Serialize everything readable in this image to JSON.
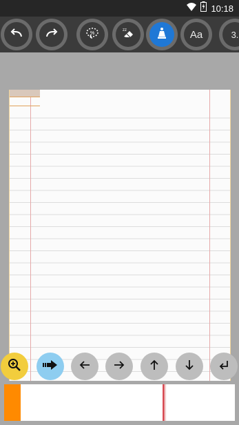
{
  "status_bar": {
    "time": "10:18"
  },
  "toolbar": {
    "tools": [
      {
        "name": "undo",
        "icon": "undo-icon"
      },
      {
        "name": "redo",
        "icon": "redo-icon"
      },
      {
        "name": "lasso",
        "icon": "lasso-icon"
      },
      {
        "name": "eraser",
        "icon": "eraser-icon"
      },
      {
        "name": "ink",
        "icon": "ink-pen-icon",
        "active": true
      },
      {
        "name": "text",
        "label": "Aa"
      },
      {
        "name": "size",
        "label": "3."
      }
    ]
  },
  "nav": {
    "buttons": [
      "zoom-icon",
      "next-page-icon",
      "arrow-left-icon",
      "arrow-right-icon",
      "arrow-up-icon",
      "arrow-down-icon",
      "enter-icon"
    ]
  },
  "colors": {
    "active_tool": "#1f78d6",
    "zoom_button": "#f2cd3d",
    "next_page_button": "#8ecdf0",
    "preview_handle": "#ff8a00"
  }
}
